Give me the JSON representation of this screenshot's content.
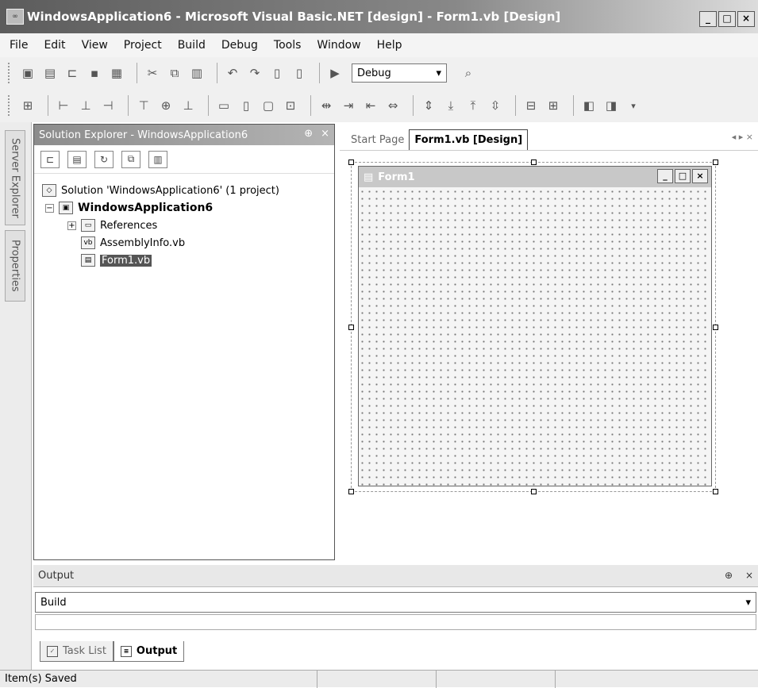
{
  "window": {
    "title": "WindowsApplication6 - Microsoft Visual Basic.NET [design] - Form1.vb [Design]",
    "icon_text": "∞",
    "min": "_",
    "max": "□",
    "close": "×"
  },
  "menu": [
    "File",
    "Edit",
    "View",
    "Project",
    "Build",
    "Debug",
    "Tools",
    "Window",
    "Help"
  ],
  "toolbar": {
    "config": "Debug"
  },
  "left_strip": {
    "server_explorer": "Server Explorer",
    "properties": "Properties"
  },
  "solution_explorer": {
    "title": "Solution Explorer - WindowsApplication6",
    "pin": "⊕",
    "close": "×",
    "solution": "Solution 'WindowsApplication6' (1 project)",
    "project": "WindowsApplication6",
    "references": "References",
    "assembly": "AssemblyInfo.vb",
    "form": "Form1.vb"
  },
  "document": {
    "tab_start": "Start Page",
    "tab_form": "Form1.vb [Design]",
    "nav": "◂ ▸ ×",
    "form_title": "Form1",
    "form_min": "_",
    "form_max": "□",
    "form_close": "×"
  },
  "output": {
    "title": "Output",
    "pin": "⊕",
    "close": "×",
    "selected": "Build"
  },
  "bottom_tabs": {
    "task_list": "Task List",
    "output": "Output"
  },
  "status": {
    "text": "Item(s) Saved"
  }
}
